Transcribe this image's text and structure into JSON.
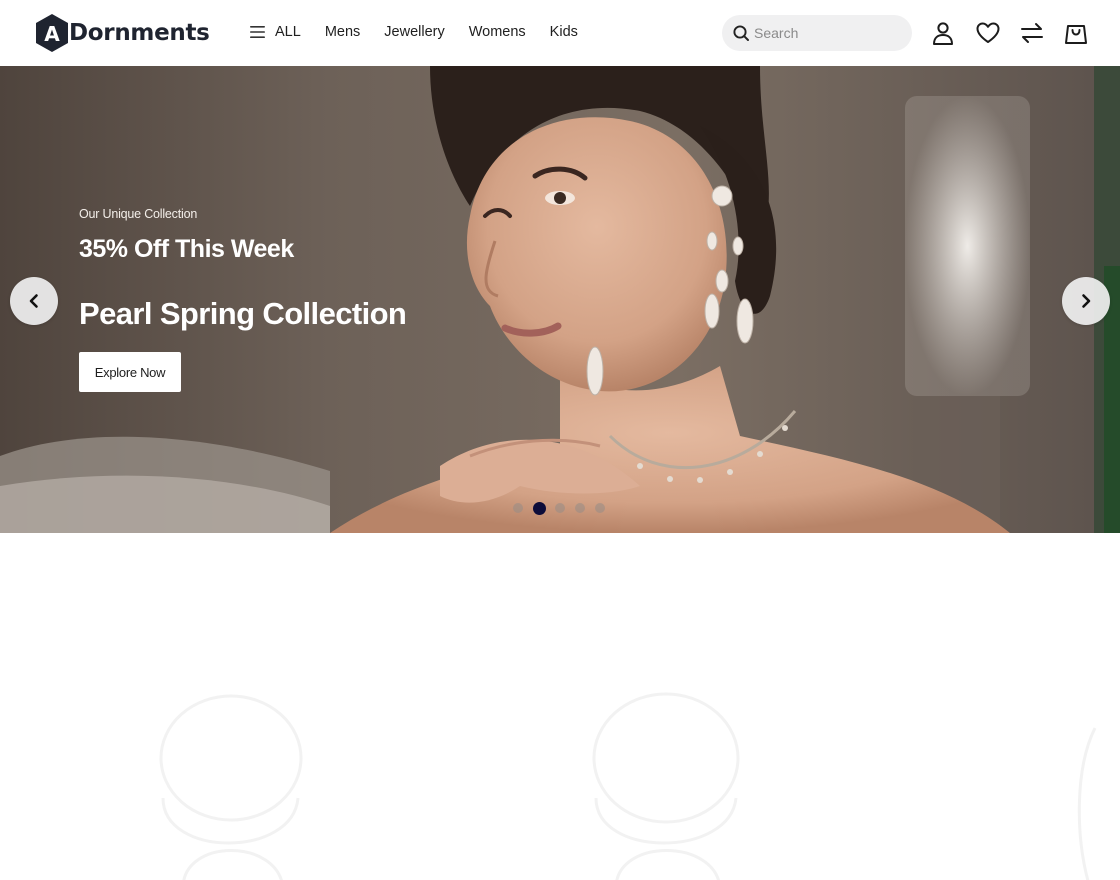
{
  "brand": {
    "name": "Dornments",
    "logo_letter": "A"
  },
  "nav": {
    "all_label": "ALL",
    "items": [
      {
        "label": "Mens"
      },
      {
        "label": "Jewellery"
      },
      {
        "label": "Womens"
      },
      {
        "label": "Kids"
      }
    ]
  },
  "search": {
    "placeholder": "Search",
    "value": ""
  },
  "header_icons": [
    "user-icon",
    "heart-icon",
    "compare-arrows-icon",
    "shopping-bag-icon"
  ],
  "hero": {
    "eyebrow": "Our Unique Collection",
    "offer": "35% Off This Week",
    "title": "Pearl Spring Collection",
    "cta_label": "Explore Now",
    "slide_count": 5,
    "active_slide": 2
  },
  "colors": {
    "active_dot": "#0c0c3a",
    "logo_badge": "#1f2430",
    "search_bg": "#f0f0f1"
  }
}
